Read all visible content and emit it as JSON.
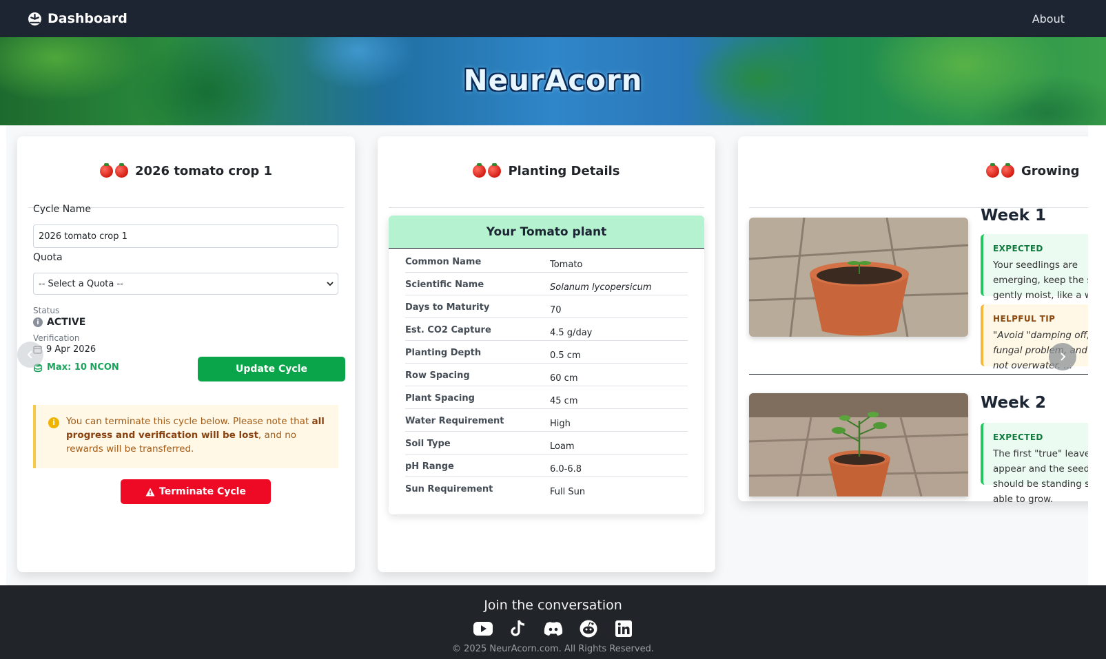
{
  "navbar": {
    "brand_label": "Dashboard",
    "about_label": "About",
    "brand_icon": "gauge-icon"
  },
  "banner": {
    "title": "NeurAcorn"
  },
  "cycle_card": {
    "title": "2026 tomato crop 1",
    "cycle_name_label": "Cycle Name",
    "cycle_name_value": "2026 tomato crop 1",
    "quota_label": "Quota",
    "quota_selected": "-- Select a Quota --",
    "status_label": "Status",
    "status_value": "ACTIVE",
    "verification_label": "Verification",
    "verification_date": "9 Apr 2026",
    "max_label": "Max: 10 NCON",
    "update_button": "Update Cycle",
    "warning_prefix": "You can terminate this cycle below. Please note that ",
    "warning_bold": "all progress and verification will be lost",
    "warning_suffix": ", and no rewards will be transferred.",
    "terminate_button": "Terminate Cycle"
  },
  "planting_card": {
    "title": "Planting Details",
    "subtitle": "Your Tomato plant",
    "rows": [
      {
        "key": "Common Name",
        "value": "Tomato"
      },
      {
        "key": "Scientific Name",
        "value": "Solanum lycopersicum"
      },
      {
        "key": "Days to Maturity",
        "value": "70"
      },
      {
        "key": "Est. CO2 Capture",
        "value": "4.5 g/day"
      },
      {
        "key": "Planting Depth",
        "value": "0.5 cm"
      },
      {
        "key": "Row Spacing",
        "value": "60 cm"
      },
      {
        "key": "Plant Spacing",
        "value": "45 cm"
      },
      {
        "key": "Water Requirement",
        "value": "High"
      },
      {
        "key": "Soil Type",
        "value": "Loam"
      },
      {
        "key": "pH Range",
        "value": "6.0-6.8"
      },
      {
        "key": "Sun Requirement",
        "value": "Full Sun"
      }
    ]
  },
  "growing_card": {
    "title": "Growing",
    "weeks": [
      {
        "title": "Week 1",
        "expected_tag": "EXPECTED",
        "expected_text": "Your seedlings are emerging, keep the soil gently moist, like a wrung-out sponge.",
        "tip_tag": "HELPFUL TIP",
        "tip_text": "\"Avoid \"damping off,\" a fungal problem, and do not overwater. ..."
      },
      {
        "title": "Week 2",
        "expected_tag": "EXPECTED",
        "expected_text": "The first \"true\" leaves appear and the seedling should be standing strong, able to grow."
      }
    ]
  },
  "footer": {
    "title": "Join the conversation",
    "copyright": "© 2025 NeurAcorn.com. All Rights Reserved.",
    "socials": [
      "youtube-icon",
      "tiktok-icon",
      "discord-icon",
      "reddit-icon",
      "linkedin-icon"
    ]
  },
  "colors": {
    "navbar": "#1e2532",
    "primary_green": "#0aa44a",
    "danger_red": "#ee0a24",
    "plant_header": "#b5f2cf",
    "footer": "#212529"
  }
}
